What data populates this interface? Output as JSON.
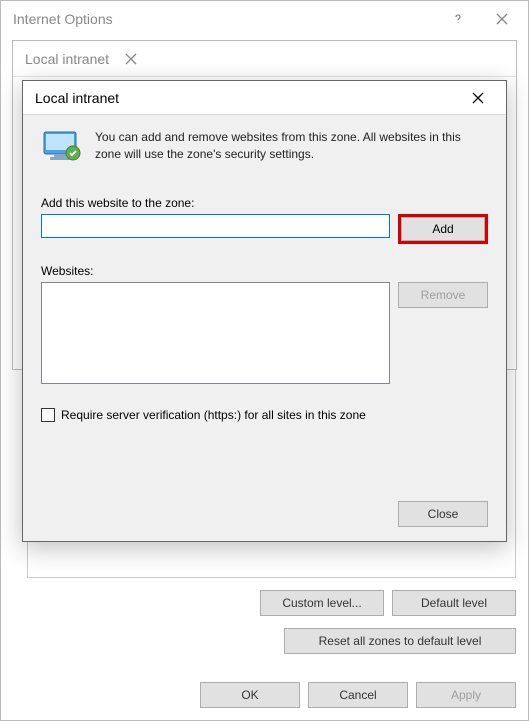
{
  "outer_window": {
    "title": "Internet Options",
    "buttons": {
      "custom_level": "Custom level...",
      "default_level": "Default level",
      "reset_all": "Reset all zones to default level",
      "ok": "OK",
      "cancel": "Cancel",
      "apply": "Apply"
    }
  },
  "mid_window": {
    "title": "Local intranet"
  },
  "top_window": {
    "title": "Local intranet",
    "info_text": "You can add and remove websites from this zone. All websites in this zone will use the zone's security settings.",
    "add_label": "Add this website to the zone:",
    "add_input_value": "",
    "add_button": "Add",
    "websites_label": "Websites:",
    "remove_button": "Remove",
    "checkbox_label": "Require server verification (https:) for all sites in this zone",
    "checkbox_checked": false,
    "close_button": "Close"
  }
}
